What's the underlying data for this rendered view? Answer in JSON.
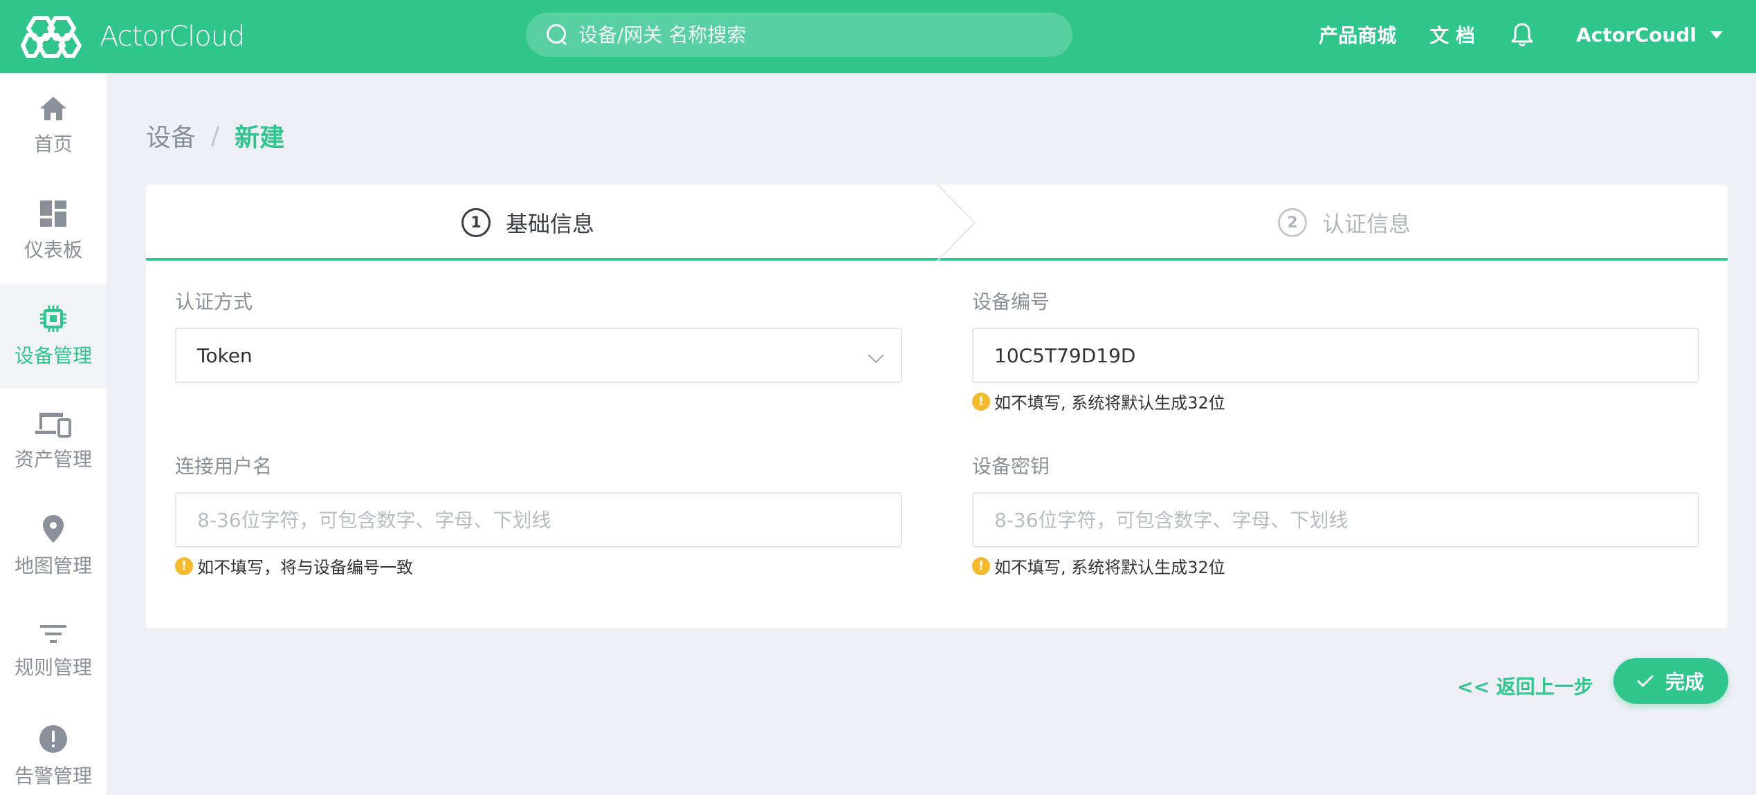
{
  "app": {
    "brand": "ActorCloud",
    "search_placeholder": "设备/网关 名称搜索"
  },
  "header": {
    "links": [
      "产品商城",
      "文 档"
    ],
    "user": "ActorCoudl"
  },
  "sidebar": {
    "items": [
      {
        "label": "首页",
        "icon": "home-icon",
        "active": false
      },
      {
        "label": "仪表板",
        "icon": "dashboard-icon",
        "active": false
      },
      {
        "label": "设备管理",
        "icon": "chip-icon",
        "active": true
      },
      {
        "label": "资产管理",
        "icon": "devices-icon",
        "active": false
      },
      {
        "label": "地图管理",
        "icon": "map-pin-icon",
        "active": false
      },
      {
        "label": "规则管理",
        "icon": "filter-icon",
        "active": false
      },
      {
        "label": "告警管理",
        "icon": "alert-icon",
        "active": false
      }
    ]
  },
  "breadcrumb": {
    "parent": "设备",
    "separator": "/",
    "current": "新建"
  },
  "steps": [
    {
      "num": "1",
      "label": "基础信息",
      "active": true
    },
    {
      "num": "2",
      "label": "认证信息",
      "active": false
    }
  ],
  "form": {
    "auth_method": {
      "label": "认证方式",
      "value": "Token"
    },
    "device_id": {
      "label": "设备编号",
      "value": "10C5T79D19D",
      "hint": "如不填写, 系统将默认生成32位"
    },
    "username": {
      "label": "连接用户名",
      "placeholder": "8-36位字符，可包含数字、字母、下划线",
      "hint": "如不填写，将与设备编号一致"
    },
    "device_key": {
      "label": "设备密钥",
      "placeholder": "8-36位字符，可包含数字、字母、下划线",
      "hint": "如不填写, 系统将默认生成32位"
    }
  },
  "actions": {
    "back": "<< 返回上一步",
    "done": "完成"
  },
  "colors": {
    "primary": "#2fc58c",
    "warning": "#f5b92e"
  }
}
